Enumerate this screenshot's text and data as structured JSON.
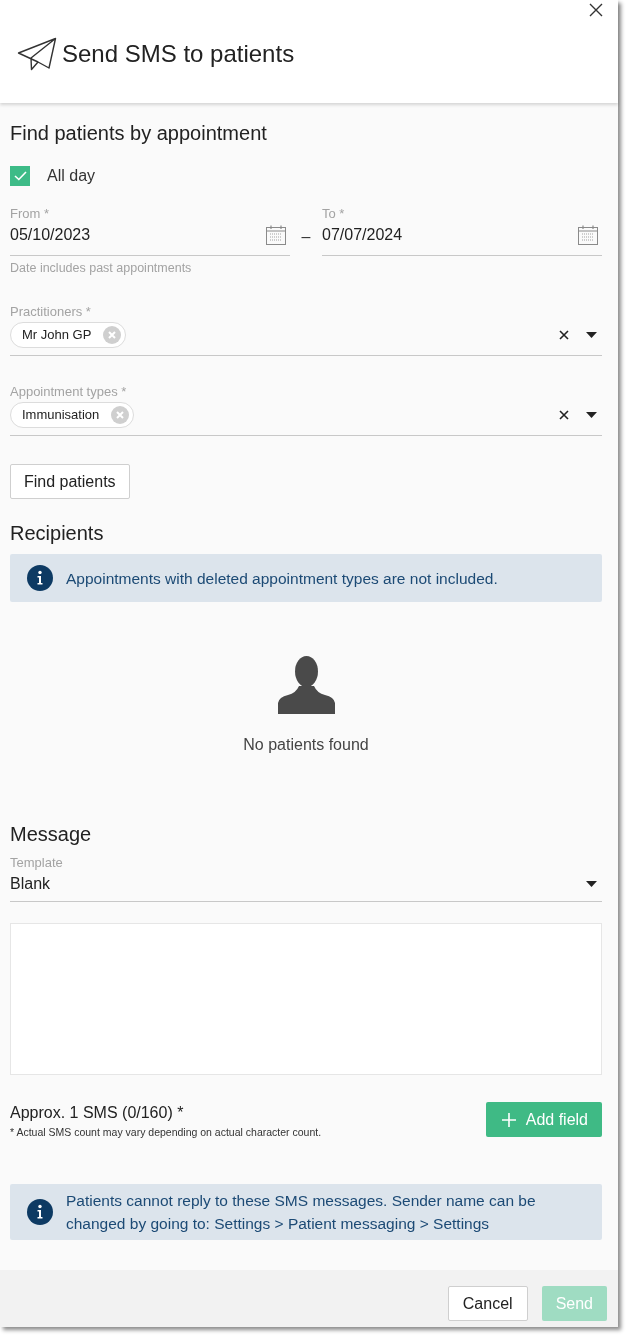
{
  "dialog": {
    "title": "Send SMS to patients"
  },
  "find_section": {
    "heading": "Find patients by appointment",
    "all_day": {
      "label": "All day",
      "checked": true
    },
    "date_from": {
      "label": "From *",
      "value": "05/10/2023"
    },
    "date_separator": "–",
    "date_to": {
      "label": "To *",
      "value": "07/07/2024"
    },
    "date_hint": "Date includes past appointments",
    "practitioners": {
      "label": "Practitioners *",
      "chips": [
        "Mr John GP"
      ]
    },
    "appointment_types": {
      "label": "Appointment types *",
      "chips": [
        "Immunisation"
      ]
    },
    "find_button": "Find patients"
  },
  "recipients": {
    "heading": "Recipients",
    "notice": "Appointments with deleted appointment types are not included.",
    "empty_text": "No patients found"
  },
  "message": {
    "heading": "Message",
    "template": {
      "label": "Template",
      "value": "Blank"
    },
    "sms_count": "Approx. 1 SMS (0/160) *",
    "sms_note": "* Actual SMS count may vary depending on actual character count.",
    "add_field_button": "Add field",
    "notice": "Patients cannot reply to these SMS messages. Sender name can be changed by going to: Settings > Patient messaging > Settings"
  },
  "footer": {
    "buttons": [
      {
        "label": "Cancel",
        "kind": "secondary",
        "disabled": false
      },
      {
        "label": "Send",
        "kind": "primary",
        "disabled": true
      }
    ]
  }
}
